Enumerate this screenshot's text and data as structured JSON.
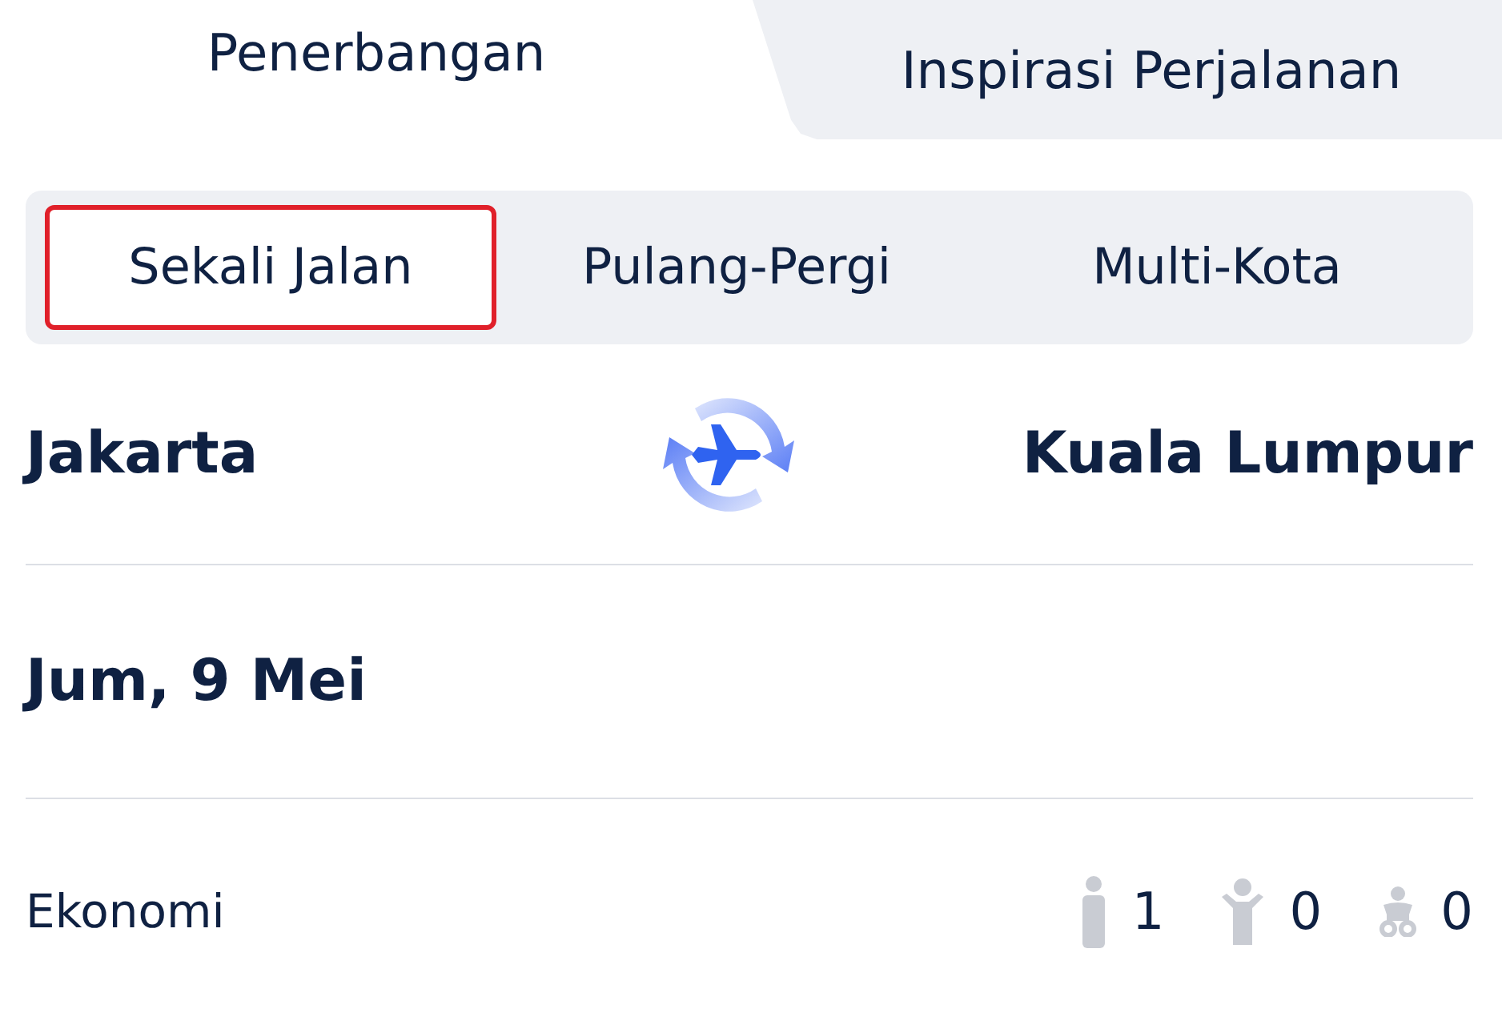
{
  "tabs": [
    {
      "label": "Penerbangan",
      "selected": true
    },
    {
      "label": "Inspirasi Perjalanan",
      "selected": false
    }
  ],
  "trip_types": [
    {
      "label": "Sekali Jalan",
      "selected": true,
      "highlighted": true
    },
    {
      "label": "Pulang-Pergi",
      "selected": false,
      "highlighted": false
    },
    {
      "label": "Multi-Kota",
      "selected": false,
      "highlighted": false
    }
  ],
  "route": {
    "origin": "Jakarta",
    "destination": "Kuala Lumpur"
  },
  "date": "Jum, 9 Mei",
  "cabin_class": "Ekonomi",
  "passengers": [
    {
      "kind": "adult",
      "count": "1"
    },
    {
      "kind": "child",
      "count": "0"
    },
    {
      "kind": "infant",
      "count": "0"
    }
  ]
}
